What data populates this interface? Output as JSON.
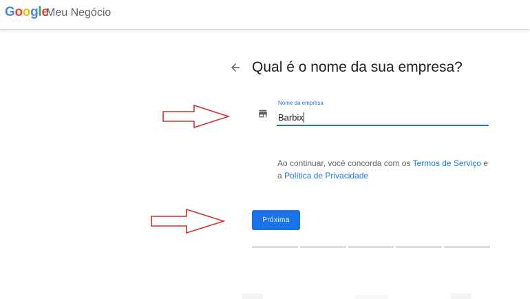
{
  "header": {
    "logo_letters": [
      {
        "char": "G",
        "color": "#4285F4"
      },
      {
        "char": "o",
        "color": "#EA4335"
      },
      {
        "char": "o",
        "color": "#FBBC05"
      },
      {
        "char": "g",
        "color": "#4285F4"
      },
      {
        "char": "l",
        "color": "#34A853"
      },
      {
        "char": "e",
        "color": "#EA4335"
      }
    ],
    "product_name": "Meu Negócio"
  },
  "main": {
    "back_icon": "arrow-back-icon",
    "heading": "Qual é o nome da sua empresa?",
    "business_field": {
      "icon": "store-icon",
      "label": "Nome da empresa",
      "value": "Barbix"
    },
    "terms": {
      "prefix": "Ao continuar, você concorda com os ",
      "terms_link": "Termos de Serviço",
      "middle": " e a ",
      "privacy_link": "Política de Privacidade"
    },
    "next_button": "Próxima",
    "progress_steps": 5
  },
  "colors": {
    "accent": "#1a73e8",
    "annotation_arrow": "#d32f2f"
  }
}
